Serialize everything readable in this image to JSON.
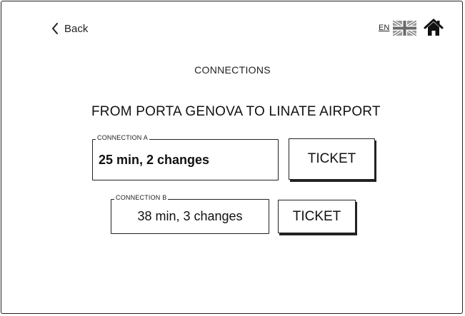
{
  "header": {
    "back_label": "Back",
    "language_code": "EN",
    "flag_icon": "uk-flag-icon",
    "home_icon": "home-icon"
  },
  "page_title": "CONNECTIONS",
  "route": "FROM PORTA GENOVA TO LINATE AIRPORT",
  "connections": [
    {
      "label": "CONNECTION A",
      "summary": "25 min, 2 changes",
      "ticket_label": "TICKET"
    },
    {
      "label": "CONNECTION B",
      "summary": "38 min, 3 changes",
      "ticket_label": "TICKET"
    }
  ]
}
